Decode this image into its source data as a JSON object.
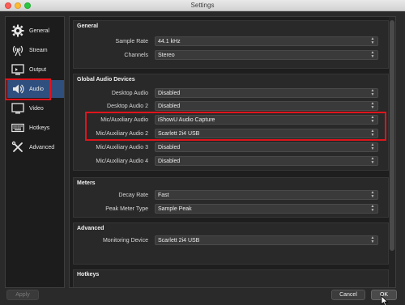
{
  "window": {
    "title": "Settings"
  },
  "sidebar": {
    "items": [
      {
        "label": "General",
        "icon": "gear-icon"
      },
      {
        "label": "Stream",
        "icon": "broadcast-icon"
      },
      {
        "label": "Output",
        "icon": "monitor-icon"
      },
      {
        "label": "Audio",
        "icon": "speaker-icon",
        "active": true
      },
      {
        "label": "Video",
        "icon": "display-icon"
      },
      {
        "label": "Hotkeys",
        "icon": "keyboard-icon"
      },
      {
        "label": "Advanced",
        "icon": "wrench-screwdriver-icon"
      }
    ]
  },
  "sections": {
    "general": {
      "title": "General",
      "rows": [
        {
          "label": "Sample Rate",
          "value": "44.1 kHz"
        },
        {
          "label": "Channels",
          "value": "Stereo"
        }
      ]
    },
    "global_audio": {
      "title": "Global Audio Devices",
      "rows": [
        {
          "label": "Desktop Audio",
          "value": "Disabled"
        },
        {
          "label": "Desktop Audio 2",
          "value": "Disabled"
        },
        {
          "label": "Mic/Auxiliary Audio",
          "value": "iShowU Audio Capture"
        },
        {
          "label": "Mic/Auxiliary Audio 2",
          "value": "Scarlett 2i4 USB"
        },
        {
          "label": "Mic/Auxiliary Audio 3",
          "value": "Disabled"
        },
        {
          "label": "Mic/Auxiliary Audio 4",
          "value": "Disabled"
        }
      ]
    },
    "meters": {
      "title": "Meters",
      "rows": [
        {
          "label": "Decay Rate",
          "value": "Fast"
        },
        {
          "label": "Peak Meter Type",
          "value": "Sample Peak"
        }
      ]
    },
    "advanced": {
      "title": "Advanced",
      "rows": [
        {
          "label": "Monitoring Device",
          "value": "Scarlett 2i4 USB"
        }
      ]
    },
    "hotkeys": {
      "title": "Hotkeys"
    }
  },
  "buttons": {
    "apply": "Apply",
    "cancel": "Cancel",
    "ok": "OK"
  },
  "colors": {
    "highlight_red": "#e0141c",
    "active_item": "#2f4f7f"
  }
}
